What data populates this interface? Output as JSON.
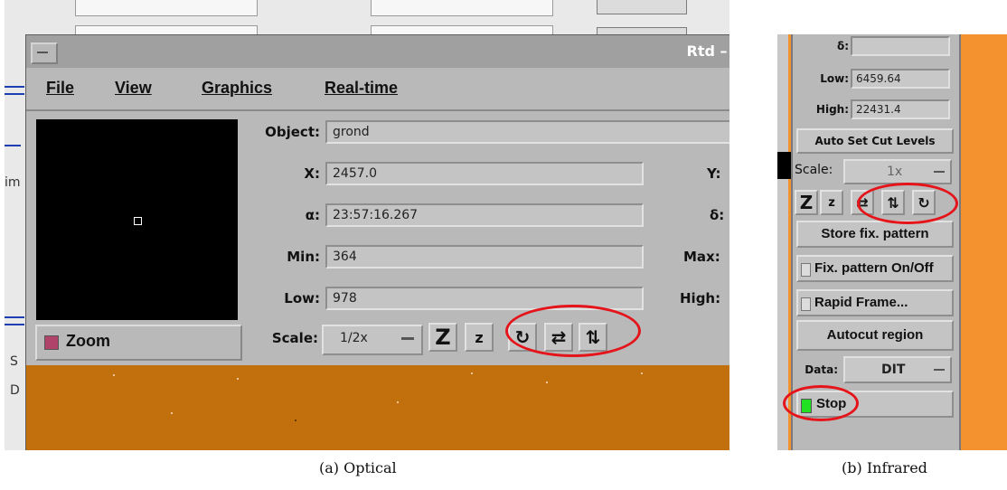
{
  "optical": {
    "window_title": "Rtd – F",
    "menu": {
      "file": "File",
      "view": "View",
      "graphics": "Graphics",
      "realtime": "Real-time"
    },
    "side_fragment_1": "im",
    "side_fragment_2": "S",
    "side_fragment_3": "D",
    "zoom_label": "Zoom",
    "object_label": "Object:",
    "object_value": "grond",
    "x_label": "X:",
    "x_value": "2457.0",
    "y_label": "Y:",
    "alpha_label": "α:",
    "alpha_value": "23:57:16.267",
    "delta_label": "δ:",
    "min_label": "Min:",
    "min_value": "364",
    "max_label": "Max:",
    "low_label": "Low:",
    "low_value": "978",
    "high_label": "High:",
    "scale_label": "Scale:",
    "scale_value": "1/2x",
    "caption": "(a)  Optical"
  },
  "infrared": {
    "delta_label": "δ:",
    "low_label": "Low:",
    "low_value": "6459.64",
    "high_label": "High:",
    "high_value": "22431.4",
    "auto_set_cut_levels": "Auto Set Cut Levels",
    "scale_label": "Scale:",
    "scale_value": "1x",
    "store_fix_pattern": "Store fix. pattern",
    "fix_pattern_onoff": "Fix. pattern On/Off",
    "rapid_frame": "Rapid Frame...",
    "autocut_region": "Autocut region",
    "data_label": "Data:",
    "data_value": "DIT",
    "stop_label": "Stop",
    "caption": "(b)  Infrared"
  },
  "icons": {
    "zoom_in": "Z",
    "zoom_out": "z",
    "rotate": "↻",
    "flip_x": "⇄",
    "flip_y": "⇅"
  },
  "colors": {
    "highlight_oval": "#e5141a",
    "image_orange": "#c2700e",
    "ir_orange": "#f3922e",
    "zoom_check": "#b0436a",
    "stop_led": "#22e022",
    "window_grey": "#b9b9b9"
  }
}
